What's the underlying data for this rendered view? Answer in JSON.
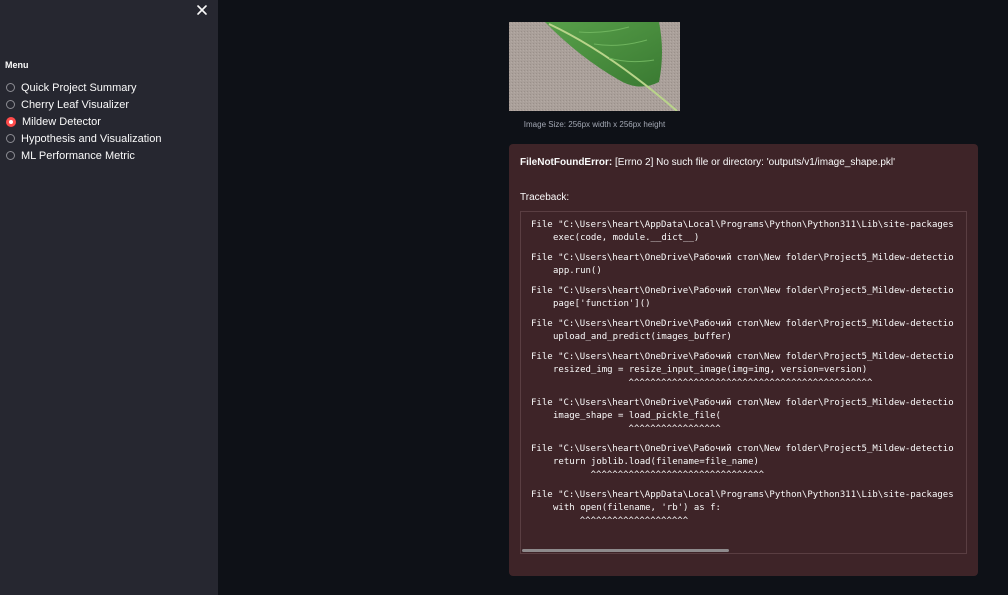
{
  "sidebar": {
    "close_icon": "close-icon",
    "menu_title": "Menu",
    "items": [
      {
        "label": "Quick Project Summary",
        "selected": false
      },
      {
        "label": "Cherry Leaf Visualizer",
        "selected": false
      },
      {
        "label": "Mildew Detector",
        "selected": true
      },
      {
        "label": "Hypothesis and Visualization",
        "selected": false
      },
      {
        "label": "ML Performance Metric",
        "selected": false
      }
    ]
  },
  "main": {
    "image_caption": "Image Size: 256px width x 256px height",
    "error": {
      "type": "FileNotFoundError:",
      "message": " [Errno 2] No such file or directory: 'outputs/v1/image_shape.pkl'",
      "traceback_label": "Traceback:",
      "frames": [
        {
          "file": "File \"C:\\Users\\heart\\AppData\\Local\\Programs\\Python\\Python311\\Lib\\site-packages",
          "code": "exec(code, module.__dict__)",
          "caret": ""
        },
        {
          "file": "File \"C:\\Users\\heart\\OneDrive\\Рабочий стол\\New folder\\Project5_Mildew-detectio",
          "code": "app.run()",
          "caret": ""
        },
        {
          "file": "File \"C:\\Users\\heart\\OneDrive\\Рабочий стол\\New folder\\Project5_Mildew-detectio",
          "code": "page['function']()",
          "caret": ""
        },
        {
          "file": "File \"C:\\Users\\heart\\OneDrive\\Рабочий стол\\New folder\\Project5_Mildew-detectio",
          "code": "upload_and_predict(images_buffer)",
          "caret": ""
        },
        {
          "file": "File \"C:\\Users\\heart\\OneDrive\\Рабочий стол\\New folder\\Project5_Mildew-detectio",
          "code": "resized_img = resize_input_image(img=img, version=version)",
          "caret": "                  ^^^^^^^^^^^^^^^^^^^^^^^^^^^^^^^^^^^^^^^^^^^^^"
        },
        {
          "file": "File \"C:\\Users\\heart\\OneDrive\\Рабочий стол\\New folder\\Project5_Mildew-detectio",
          "code": "image_shape = load_pickle_file(",
          "caret": "                  ^^^^^^^^^^^^^^^^^"
        },
        {
          "file": "File \"C:\\Users\\heart\\OneDrive\\Рабочий стол\\New folder\\Project5_Mildew-detectio",
          "code": "return joblib.load(filename=file_name)",
          "caret": "           ^^^^^^^^^^^^^^^^^^^^^^^^^^^^^^^^"
        },
        {
          "file": "File \"C:\\Users\\heart\\AppData\\Local\\Programs\\Python\\Python311\\Lib\\site-packages",
          "code": "with open(filename, 'rb') as f:",
          "caret": "         ^^^^^^^^^^^^^^^^^^^^"
        }
      ]
    }
  },
  "colors": {
    "sidebar_bg": "#262730",
    "main_bg": "#0e1117",
    "accent": "#ff4b4b",
    "error_bg": "#3e2428"
  }
}
